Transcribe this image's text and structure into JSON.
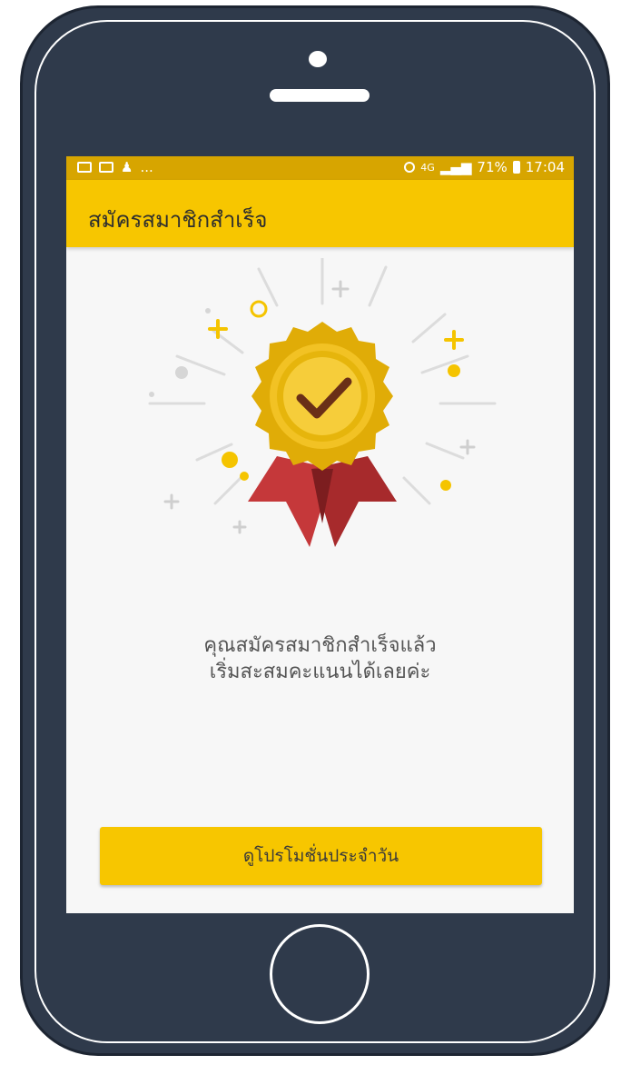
{
  "statusbar": {
    "left_ellipsis": "...",
    "network": "4G",
    "battery": "71%",
    "time": "17:04"
  },
  "appbar": {
    "title": "สมัครสมาชิกสำเร็จ"
  },
  "message": {
    "line1": "คุณสมัครสมาชิกสำเร็จแล้ว",
    "line2": "เริ่มสะสมคะแนนได้เลยค่ะ"
  },
  "actions": {
    "promo_button": "ดูโปรโมชั่นประจำวัน"
  },
  "icons": {
    "illustration": "award-medal-checkmark"
  },
  "colors": {
    "accent": "#f7c600",
    "statusbar": "#d7a500",
    "ribbon": "#b93331",
    "phone_body": "#2f3a4b"
  }
}
